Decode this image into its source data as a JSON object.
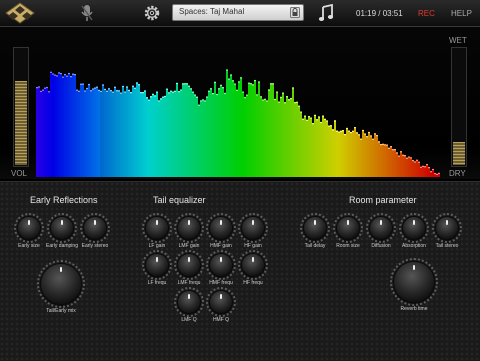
{
  "topbar": {
    "preset_label": "Spaces: Taj Mahal",
    "time": "01:19 / 03:51",
    "rec_label": "REC",
    "help_label": "HELP",
    "icons": [
      "logo-diamond-icon",
      "microphone-icon",
      "gear-icon",
      "lock-icon",
      "music-note-icon"
    ]
  },
  "meters": {
    "vol_label": "VOL",
    "wet_label": "WET",
    "dry_label": "DRY",
    "vol_level": 0.72,
    "wet_level": 0.2
  },
  "sections": {
    "early": "Early Reflections",
    "tail": "Tail equalizer",
    "room": "Room parameter"
  },
  "knobs": {
    "early_size": "Early size",
    "early_damping": "Early damping",
    "early_stereo": "Early stereo",
    "tail_early_mix": "Tail/Early mix",
    "lf_gain": "LF gain",
    "lmf_gain": "LMF gain",
    "hmf_gain": "HMF gain",
    "hf_gain": "HF gain",
    "lf_frequ": "LF frequ",
    "lmf_frequ": "LMF frequ",
    "hmf_frequ": "HMF frequ",
    "hf_frequ": "HF frequ",
    "lmf_q": "LMF Q",
    "hmf_q": "HMF Q",
    "tail_delay": "Tail delay",
    "room_size": "Room size",
    "diffusion": "Diffusion",
    "absorption": "Absorption",
    "tail_stereo": "Tail stereo",
    "reverb_time": "Reverb time"
  },
  "colors": {
    "rec": "#e03a2c",
    "meter": "#b7a05a",
    "panel": "#1a1a1a"
  }
}
